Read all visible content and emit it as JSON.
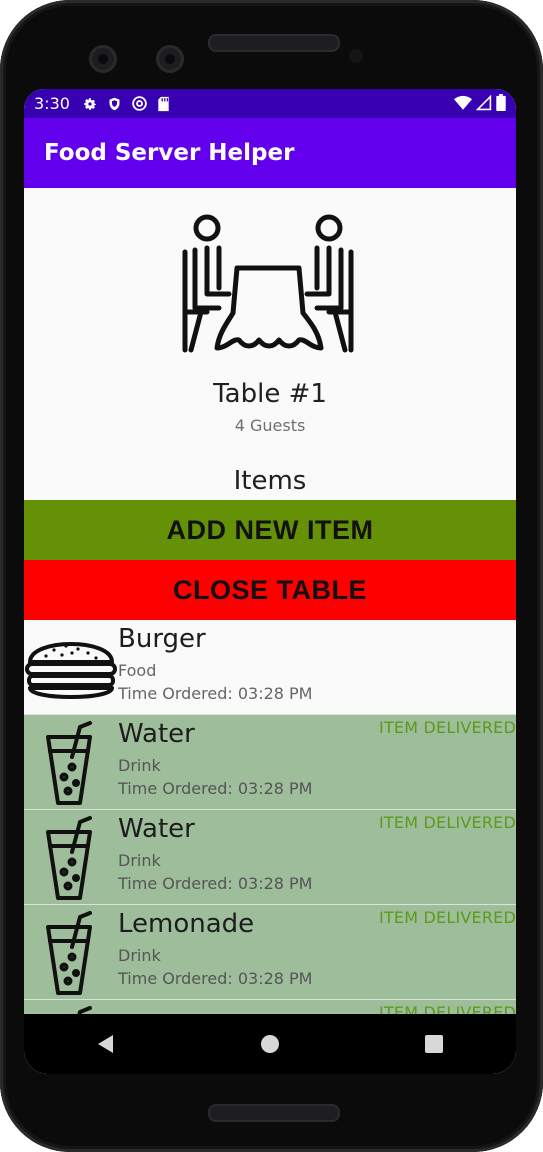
{
  "status_bar": {
    "time": "3:30",
    "left_icons": [
      "gear-icon",
      "shield-icon",
      "at-sign-icon",
      "sd-card-icon"
    ],
    "right_icons": [
      "wifi-icon",
      "signal-icon",
      "battery-icon"
    ]
  },
  "app": {
    "title": "Food Server Helper"
  },
  "table": {
    "name": "Table #1",
    "guests": "4 Guests",
    "items_heading": "Items"
  },
  "actions": {
    "add_item": "ADD NEW ITEM",
    "close_table": "CLOSE TABLE"
  },
  "colors": {
    "status_bar": "#3700b3",
    "app_bar": "#6200ee",
    "add_button": "#649106",
    "close_button": "#ff0000",
    "delivered_row": "#9ebd9b",
    "delivered_text": "#5c9a1b"
  },
  "items": [
    {
      "name": "Burger",
      "category": "Food",
      "time": "Time Ordered: 03:28 PM",
      "status": "",
      "icon": "burger-icon"
    },
    {
      "name": "Water",
      "category": "Drink",
      "time": "Time Ordered: 03:28 PM",
      "status": "ITEM DELIVERED",
      "icon": "drink-icon"
    },
    {
      "name": "Water",
      "category": "Drink",
      "time": "Time Ordered: 03:28 PM",
      "status": "ITEM DELIVERED",
      "icon": "drink-icon"
    },
    {
      "name": "Lemonade",
      "category": "Drink",
      "time": "Time Ordered: 03:28 PM",
      "status": "ITEM DELIVERED",
      "icon": "drink-icon"
    },
    {
      "name": "",
      "category": "",
      "time": "",
      "status": "ITEM DELIVERED",
      "icon": "drink-icon"
    }
  ],
  "nav": [
    "back-icon",
    "home-icon",
    "recents-icon"
  ]
}
